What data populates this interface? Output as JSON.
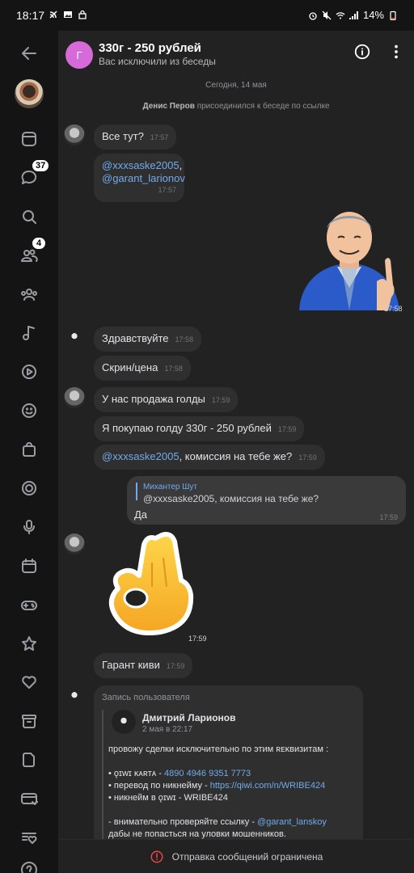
{
  "status_bar": {
    "time": "18:17",
    "battery": "14%",
    "signal": "4G"
  },
  "sidebar": {
    "items": [
      {
        "icon": "back-arrow-icon"
      },
      {
        "icon": "profile-avatar"
      },
      {
        "icon": "news-icon"
      },
      {
        "icon": "messages-icon",
        "badge": "37"
      },
      {
        "icon": "search-icon"
      },
      {
        "icon": "friends-icon",
        "badge": "4"
      },
      {
        "icon": "communities-icon"
      },
      {
        "icon": "music-icon"
      },
      {
        "icon": "video-icon"
      },
      {
        "icon": "stickers-icon"
      },
      {
        "icon": "shopping-bag-icon"
      },
      {
        "icon": "target-icon"
      },
      {
        "icon": "podcast-icon"
      },
      {
        "icon": "calendar-icon"
      },
      {
        "icon": "games-icon"
      },
      {
        "icon": "bookmarks-star-icon"
      },
      {
        "icon": "likes-heart-icon"
      },
      {
        "icon": "archive-icon"
      },
      {
        "icon": "documents-icon"
      },
      {
        "icon": "payments-icon"
      },
      {
        "icon": "donations-icon"
      },
      {
        "icon": "help-icon"
      }
    ]
  },
  "header": {
    "avatar_letter": "Г",
    "title": "330г - 250 рублей",
    "subtitle": "Вас исключили из беседы"
  },
  "system": {
    "date": "Сегодня, 14 мая",
    "join_name": "Денис Перов",
    "join_text": "присоединился к беседе по ссылке"
  },
  "messages": {
    "m1": {
      "text": "Все тут?",
      "time": "17:57"
    },
    "m2": {
      "mention1": "@xxxsaske2005",
      "comma": ",",
      "mention2": "@garant_larionov",
      "time": "17:57"
    },
    "sticker1": {
      "time": "17:58"
    },
    "m3": {
      "text": "Здравствуйте",
      "time": "17:58"
    },
    "m4": {
      "text": "Скрин/цена",
      "time": "17:58"
    },
    "m5": {
      "text": "У нас продажа голды",
      "time": "17:59"
    },
    "m6": {
      "text": "Я покупаю голду 330г - 250 рублей",
      "time": "17:59"
    },
    "m7": {
      "mention": "@xxxsaske2005",
      "text": ", комиссия на тебе же?",
      "time": "17:59"
    },
    "reply": {
      "quoted_name": "Михантер Шут",
      "quoted_text": "@xxxsaske2005, комиссия на тебе же?",
      "text": "Да",
      "time": "17:59"
    },
    "sticker2": {
      "time": "17:59"
    },
    "m8": {
      "text": "Гарант киви",
      "time": "17:59"
    },
    "repost": {
      "label": "Запись пользователя",
      "author": "Дмитрий Ларионов",
      "date": "2 мая в 22:17",
      "line1": "провожу сделки исключительно по этим ʀᴇᴋʙизитам :",
      "line2_prefix": "• ǫɪwɪ ᴋᴀʀᴛᴀ - ",
      "line2_value": "4890 4946 9351 7773",
      "line3_prefix": "• перевод по никнейму -  ",
      "line3_value": "https://qiwi.com/n/WRIBE424",
      "line4": "• никнейм в ǫɪwɪ - WRIBE424",
      "line5_prefix": "- внимательно проверяйте ссылку - ",
      "line5_value": "@garant_lanskoy",
      "line6": "дабы не попасться на уловки мошенников."
    }
  },
  "footer": {
    "text": "Отправка сообщений ограничена"
  }
}
